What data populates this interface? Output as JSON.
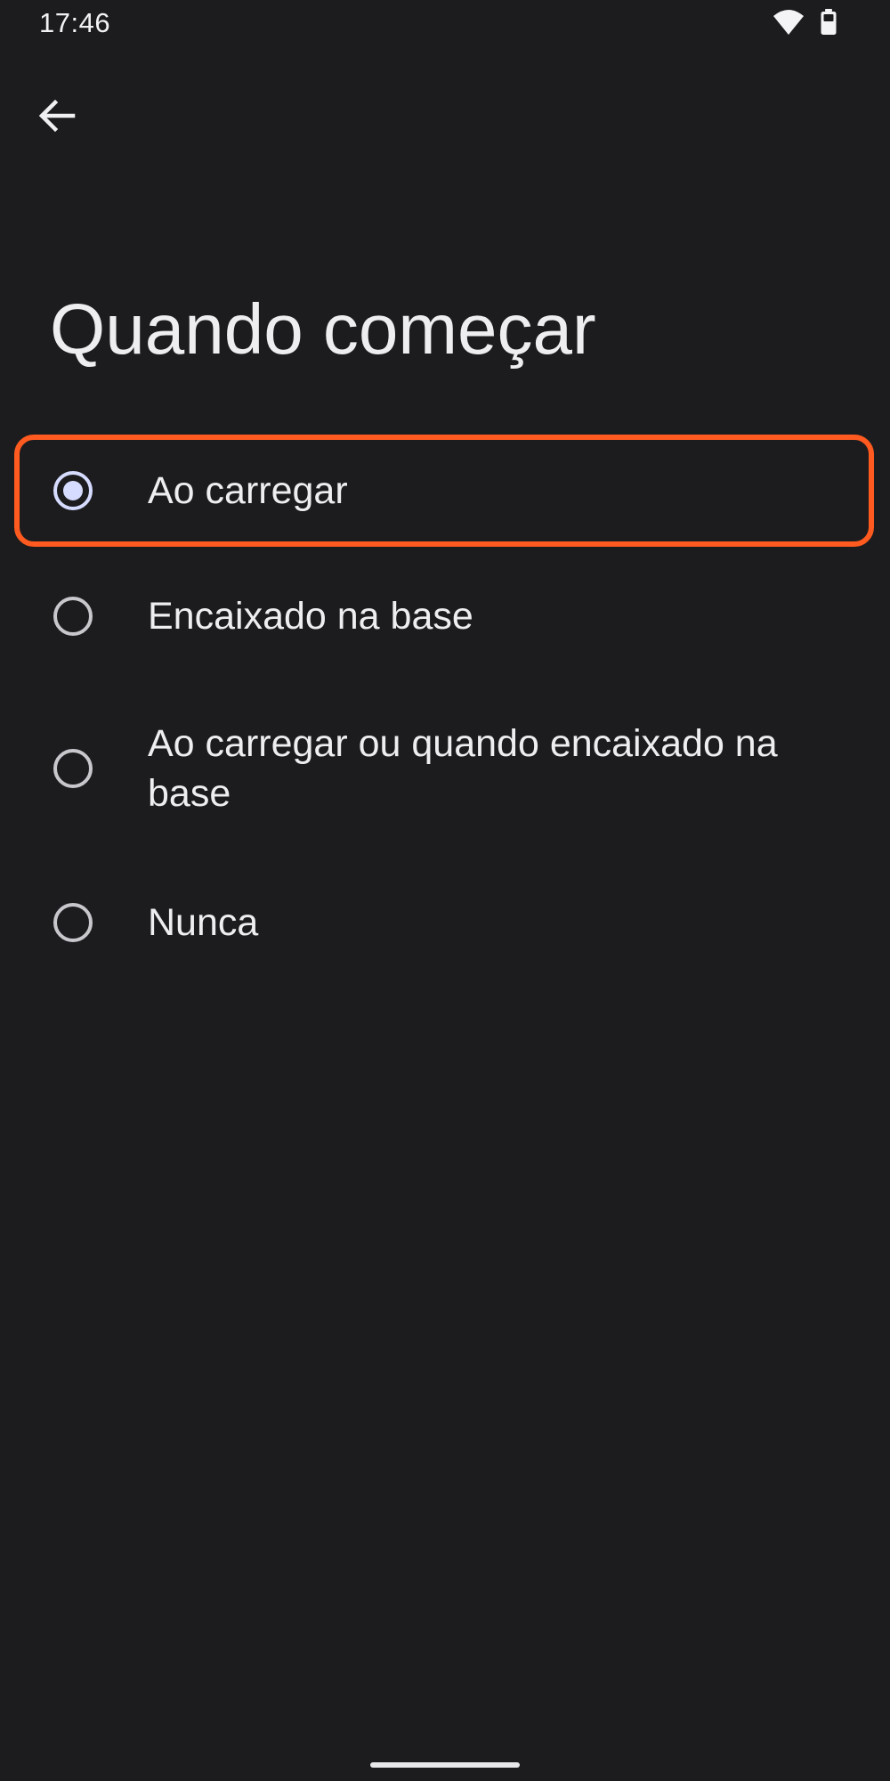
{
  "status_bar": {
    "time": "17:46",
    "icons": [
      "wifi-icon",
      "battery-icon"
    ]
  },
  "toolbar": {
    "back_icon": "arrow-back-icon"
  },
  "page": {
    "title": "Quando começar"
  },
  "options": [
    {
      "label": "Ao carregar",
      "selected": true
    },
    {
      "label": "Encaixado na base",
      "selected": false
    },
    {
      "label": "Ao carregar ou quando encaixado na base",
      "selected": false
    },
    {
      "label": "Nunca",
      "selected": false
    }
  ],
  "colors": {
    "background": "#1c1c1e",
    "accent": "#d6dcff",
    "highlight": "#ff5a1f"
  }
}
